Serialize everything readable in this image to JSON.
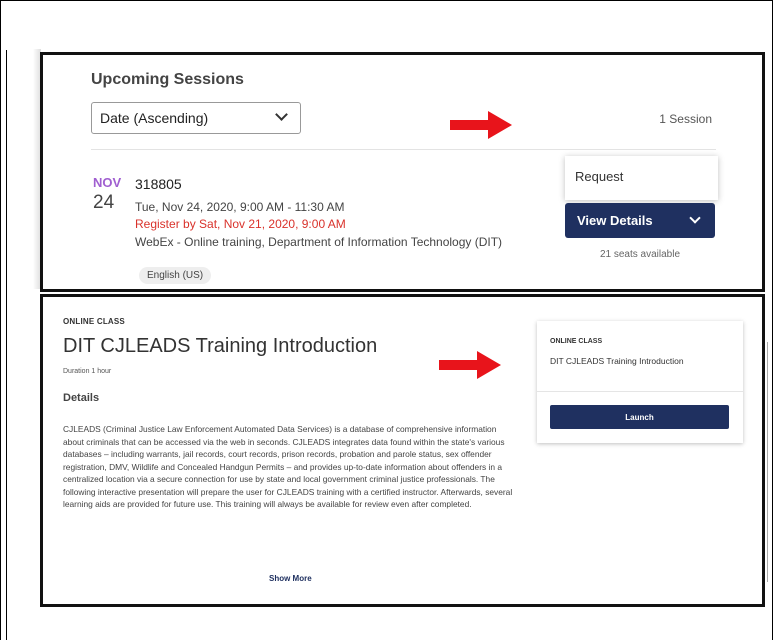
{
  "upcoming": {
    "title": "Upcoming Sessions",
    "sort_value": "Date (Ascending)",
    "session_count": "1 Session"
  },
  "session": {
    "month": "NOV",
    "day": "24",
    "id": "318805",
    "time": "Tue, Nov 24, 2020, 9:00 AM - 11:30 AM",
    "register_by": "Register by Sat, Nov 21, 2020, 9:00 AM",
    "location": "WebEx - Online training, Department of Information Technology (DIT)",
    "language": "English (US)",
    "request_label": "Request",
    "view_details_label": "View Details",
    "seats": "21 seats available"
  },
  "course": {
    "type_label": "ONLINE CLASS",
    "title": "DIT CJLEADS Training Introduction",
    "duration": "Duration  1 hour",
    "details_heading": "Details",
    "description": "CJLEADS (Criminal Justice Law Enforcement Automated Data Services) is a database of comprehensive information about criminals that can be accessed via the web in seconds. CJLEADS integrates data found within the state's various databases – including warrants, jail records, court records, prison records, probation and parole status, sex offender registration, DMV, Wildlife and Concealed Handgun Permits – and provides up-to-date information about offenders in a centralized location via a secure connection for use by state and local government criminal justice professionals. The following interactive presentation will prepare the user for CJLEADS training with a certified instructor. Afterwards, several learning aids are provided for future use. This training will always be available for review even after completed.",
    "show_more": "Show More"
  },
  "launch_card": {
    "type_label": "ONLINE CLASS",
    "title": "DIT CJLEADS Training Introduction",
    "launch_label": "Launch"
  },
  "colors": {
    "arrow": "#e8141b",
    "button_navy": "#1f3060",
    "month_purple": "#a05fd0",
    "register_red": "#d9322b"
  },
  "icons": [
    "chevron-down-icon",
    "red-arrow-icon"
  ]
}
